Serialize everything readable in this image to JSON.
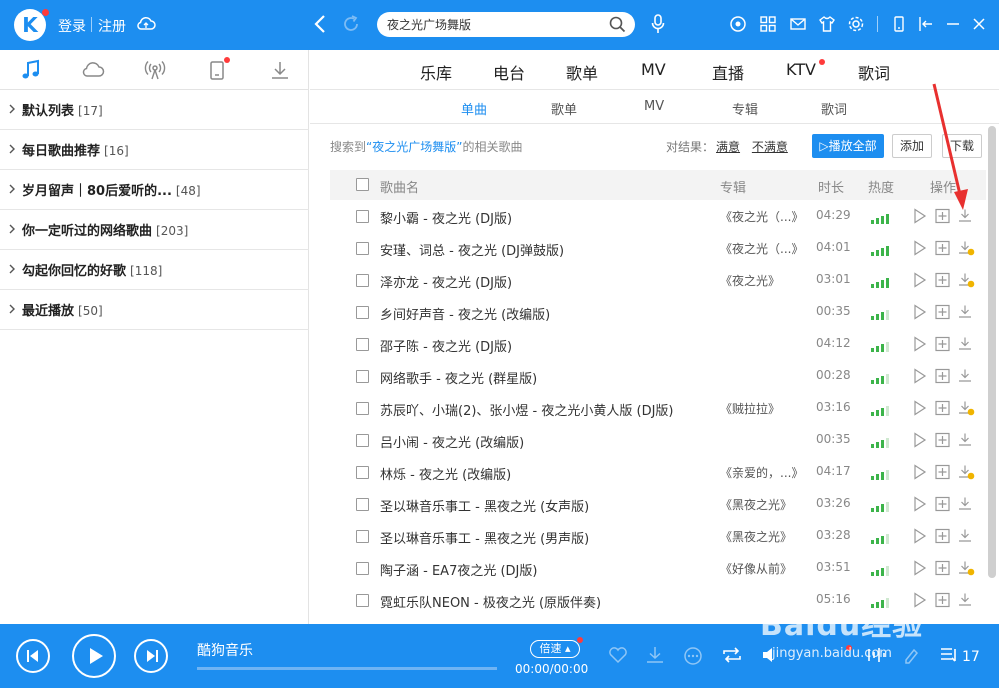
{
  "header": {
    "logo": "K",
    "login": "登录",
    "register": "注册",
    "search_value": "夜之光广场舞版"
  },
  "sidebar": {
    "tabs": [
      "music-note-icon",
      "cloud-icon",
      "radio-icon",
      "phone-icon",
      "download-icon"
    ],
    "playlists": [
      {
        "name": "默认列表",
        "count": "[17]"
      },
      {
        "name": "每日歌曲推荐",
        "count": "[16]"
      },
      {
        "name": "岁月留声｜80后爱听的...",
        "count": "[48]"
      },
      {
        "name": "你一定听过的网络歌曲",
        "count": "[203]"
      },
      {
        "name": "勾起你回忆的好歌",
        "count": "[118]"
      },
      {
        "name": "最近播放",
        "count": "[50]"
      }
    ]
  },
  "main": {
    "categories": [
      "乐库",
      "电台",
      "歌单",
      "MV",
      "直播",
      "KTV",
      "歌词"
    ],
    "sub_tabs": [
      "单曲",
      "歌单",
      "MV",
      "专辑",
      "歌词"
    ],
    "active_sub_tab": "单曲",
    "result_prefix": "搜索到",
    "result_keyword": "“夜之光广场舞版”",
    "result_suffix": "的相关歌曲",
    "feedback_label": "对结果：",
    "feedback_good": "满意",
    "feedback_bad": "不满意",
    "play_all": "播放全部",
    "add": "添加",
    "download": "下载",
    "columns": {
      "title": "歌曲名",
      "album": "专辑",
      "duration": "时长",
      "heat": "热度",
      "ops": "操作"
    },
    "songs": [
      {
        "title": "黎小霸 - 夜之光 (DJ版)",
        "album": "《夜之光（...》",
        "duration": "04:29",
        "heat": 4,
        "vip": false
      },
      {
        "title": "安瑾、词总 - 夜之光 (DJ弹鼓版)",
        "album": "《夜之光（...》",
        "duration": "04:01",
        "heat": 4,
        "vip": true
      },
      {
        "title": "泽亦龙 - 夜之光 (DJ版)",
        "album": "《夜之光》",
        "duration": "03:01",
        "heat": 4,
        "vip": true
      },
      {
        "title": "乡间好声音 - 夜之光 (改编版)",
        "album": "",
        "duration": "00:35",
        "heat": 3,
        "vip": false
      },
      {
        "title": "邵子陈 - 夜之光 (DJ版)",
        "album": "",
        "duration": "04:12",
        "heat": 3,
        "vip": false
      },
      {
        "title": "网络歌手 - 夜之光 (群星版)",
        "album": "",
        "duration": "00:28",
        "heat": 3,
        "vip": false
      },
      {
        "title": "苏辰吖、小瑞(2)、张小煜 - 夜之光小黄人版 (DJ版)",
        "album": "《贼拉拉》",
        "duration": "03:16",
        "heat": 3,
        "vip": true
      },
      {
        "title": "吕小闹 - 夜之光 (改编版)",
        "album": "",
        "duration": "00:35",
        "heat": 3,
        "vip": false
      },
      {
        "title": "林烁 - 夜之光 (改编版)",
        "album": "《亲爱的，...》",
        "duration": "04:17",
        "heat": 3,
        "vip": true
      },
      {
        "title": "圣以琳音乐事工 - 黑夜之光 (女声版)",
        "album": "《黑夜之光》",
        "duration": "03:26",
        "heat": 3,
        "vip": false
      },
      {
        "title": "圣以琳音乐事工 - 黑夜之光 (男声版)",
        "album": "《黑夜之光》",
        "duration": "03:28",
        "heat": 3,
        "vip": false
      },
      {
        "title": "陶子涵 - EA7夜之光 (DJ版)",
        "album": "《好像从前》",
        "duration": "03:51",
        "heat": 3,
        "vip": true
      },
      {
        "title": "霓虹乐队NEON - 极夜之光 (原版伴奏)",
        "album": "",
        "duration": "05:16",
        "heat": 3,
        "vip": false
      }
    ]
  },
  "player": {
    "now_playing": "酷狗音乐",
    "speed": "倍速",
    "time": "00:00/00:00",
    "queue_count": "17",
    "progress": 0
  },
  "watermark": {
    "main": "Baidu经验",
    "sub": "jingyan.baidu.com"
  },
  "colors": {
    "brand": "#1d8ef0",
    "heat_on": "#3cb44a",
    "heat_off": "#cfe9d0",
    "vip": "#f0b400",
    "badge": "#ff3b3b"
  }
}
